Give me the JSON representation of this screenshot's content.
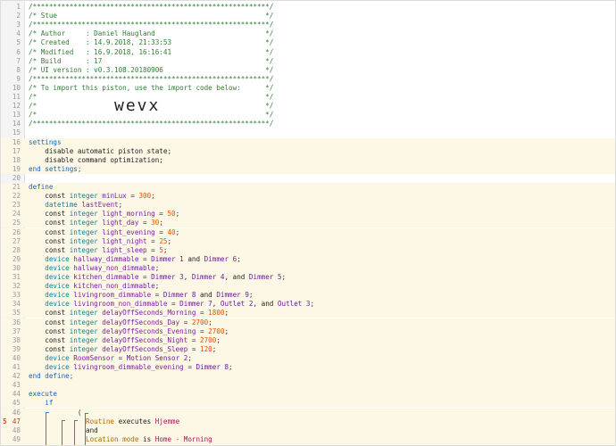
{
  "editor": {
    "banner_text": "wevx",
    "error_marker": "5",
    "lines": [
      {
        "n": "1",
        "segs": [
          {
            "t": "/**********************************************************/",
            "c": "comment"
          }
        ]
      },
      {
        "n": "2",
        "segs": [
          {
            "t": "/* Stue                                                   */",
            "c": "comment"
          }
        ]
      },
      {
        "n": "3",
        "segs": [
          {
            "t": "/**********************************************************/",
            "c": "comment"
          }
        ]
      },
      {
        "n": "4",
        "segs": [
          {
            "t": "/* Author     : Daniel Haugland                           */",
            "c": "comment"
          }
        ]
      },
      {
        "n": "5",
        "segs": [
          {
            "t": "/* Created    : 14.9.2018, 21:33:53                       */",
            "c": "comment"
          }
        ]
      },
      {
        "n": "6",
        "segs": [
          {
            "t": "/* Modified   : 16.9.2018, 16:16:41                       */",
            "c": "comment"
          }
        ]
      },
      {
        "n": "7",
        "segs": [
          {
            "t": "/* Build      : 17                                        */",
            "c": "comment"
          }
        ]
      },
      {
        "n": "8",
        "segs": [
          {
            "t": "/* UI version : v0.3.108.20180906                         */",
            "c": "comment"
          }
        ]
      },
      {
        "n": "9",
        "segs": [
          {
            "t": "/**********************************************************/",
            "c": "comment"
          }
        ]
      },
      {
        "n": "10",
        "segs": [
          {
            "t": "/* To import this piston, use the import code below:      */",
            "c": "comment"
          }
        ]
      },
      {
        "n": "11",
        "segs": [
          {
            "t": "/*                                                        */",
            "c": "comment"
          }
        ]
      },
      {
        "n": "12",
        "segs": [
          {
            "t": "/*                                                        */",
            "c": "comment"
          }
        ]
      },
      {
        "n": "13",
        "segs": [
          {
            "t": "/*                                                        */",
            "c": "comment"
          }
        ]
      },
      {
        "n": "14",
        "segs": [
          {
            "t": "/**********************************************************/",
            "c": "comment"
          }
        ]
      },
      {
        "n": "15",
        "segs": []
      },
      {
        "n": "16",
        "segs": [
          {
            "t": "settings",
            "c": "kw"
          }
        ]
      },
      {
        "n": "17",
        "segs": [
          {
            "t": "    disable automatic piston state;",
            "c": "plain"
          }
        ]
      },
      {
        "n": "18",
        "segs": [
          {
            "t": "    disable command optimization;",
            "c": "plain"
          }
        ]
      },
      {
        "n": "19",
        "segs": [
          {
            "t": "end settings;",
            "c": "kw"
          }
        ]
      },
      {
        "n": "20",
        "segs": []
      },
      {
        "n": "21",
        "segs": [
          {
            "t": "define",
            "c": "kw"
          }
        ]
      },
      {
        "n": "22",
        "segs": [
          {
            "t": "    const ",
            "c": "plain"
          },
          {
            "t": "integer ",
            "c": "type"
          },
          {
            "t": "minLux",
            "c": "decl"
          },
          {
            "t": " = ",
            "c": "op"
          },
          {
            "t": "300",
            "c": "num"
          },
          {
            "t": ";",
            "c": "op"
          }
        ]
      },
      {
        "n": "23",
        "segs": [
          {
            "t": "    datetime ",
            "c": "type"
          },
          {
            "t": "lastEvent",
            "c": "decl"
          },
          {
            "t": ";",
            "c": "op"
          }
        ]
      },
      {
        "n": "24",
        "segs": [
          {
            "t": "    const ",
            "c": "plain"
          },
          {
            "t": "integer ",
            "c": "type"
          },
          {
            "t": "light_morning",
            "c": "decl"
          },
          {
            "t": " = ",
            "c": "op"
          },
          {
            "t": "50",
            "c": "num"
          },
          {
            "t": ";",
            "c": "op"
          }
        ]
      },
      {
        "n": "25",
        "segs": [
          {
            "t": "    const ",
            "c": "plain"
          },
          {
            "t": "integer ",
            "c": "type"
          },
          {
            "t": "light_day",
            "c": "decl"
          },
          {
            "t": " = ",
            "c": "op"
          },
          {
            "t": "30",
            "c": "num"
          },
          {
            "t": ";",
            "c": "op"
          }
        ]
      },
      {
        "n": "26",
        "segs": [
          {
            "t": "    const ",
            "c": "plain"
          },
          {
            "t": "integer ",
            "c": "type"
          },
          {
            "t": "light_evening",
            "c": "decl"
          },
          {
            "t": " = ",
            "c": "op"
          },
          {
            "t": "40",
            "c": "num"
          },
          {
            "t": ";",
            "c": "op"
          }
        ]
      },
      {
        "n": "27",
        "segs": [
          {
            "t": "    const ",
            "c": "plain"
          },
          {
            "t": "integer ",
            "c": "type"
          },
          {
            "t": "light_night",
            "c": "decl"
          },
          {
            "t": " = ",
            "c": "op"
          },
          {
            "t": "25",
            "c": "num"
          },
          {
            "t": ";",
            "c": "op"
          }
        ]
      },
      {
        "n": "28",
        "segs": [
          {
            "t": "    const ",
            "c": "plain"
          },
          {
            "t": "integer ",
            "c": "type"
          },
          {
            "t": "light_sleep",
            "c": "decl"
          },
          {
            "t": " = ",
            "c": "op"
          },
          {
            "t": "5",
            "c": "num"
          },
          {
            "t": ";",
            "c": "op"
          }
        ]
      },
      {
        "n": "29",
        "segs": [
          {
            "t": "    device ",
            "c": "type"
          },
          {
            "t": "hallway_dimmable",
            "c": "decl"
          },
          {
            "t": " = ",
            "c": "op"
          },
          {
            "t": "Dimmer 1",
            "c": "dev"
          },
          {
            "t": " and ",
            "c": "plain"
          },
          {
            "t": "Dimmer 6",
            "c": "dev"
          },
          {
            "t": ";",
            "c": "op"
          }
        ]
      },
      {
        "n": "30",
        "segs": [
          {
            "t": "    device ",
            "c": "type"
          },
          {
            "t": "hallway_non_dimmable",
            "c": "decl"
          },
          {
            "t": ";",
            "c": "op"
          }
        ]
      },
      {
        "n": "31",
        "segs": [
          {
            "t": "    device ",
            "c": "type"
          },
          {
            "t": "kitchen_dimmable",
            "c": "decl"
          },
          {
            "t": " = ",
            "c": "op"
          },
          {
            "t": "Dimmer 3",
            "c": "dev"
          },
          {
            "t": ", ",
            "c": "plain"
          },
          {
            "t": "Dimmer 4",
            "c": "dev"
          },
          {
            "t": ", and ",
            "c": "plain"
          },
          {
            "t": "Dimmer 5",
            "c": "dev"
          },
          {
            "t": ";",
            "c": "op"
          }
        ]
      },
      {
        "n": "32",
        "segs": [
          {
            "t": "    device ",
            "c": "type"
          },
          {
            "t": "kitchen_non_dimmable",
            "c": "decl"
          },
          {
            "t": ";",
            "c": "op"
          }
        ]
      },
      {
        "n": "33",
        "segs": [
          {
            "t": "    device ",
            "c": "type"
          },
          {
            "t": "livingroom_dimmable",
            "c": "decl"
          },
          {
            "t": " = ",
            "c": "op"
          },
          {
            "t": "Dimmer 8",
            "c": "dev"
          },
          {
            "t": " and ",
            "c": "plain"
          },
          {
            "t": "Dimmer 9",
            "c": "dev"
          },
          {
            "t": ";",
            "c": "op"
          }
        ]
      },
      {
        "n": "34",
        "segs": [
          {
            "t": "    device ",
            "c": "type"
          },
          {
            "t": "livingroom_non_dimmable",
            "c": "decl"
          },
          {
            "t": " = ",
            "c": "op"
          },
          {
            "t": "Dimmer 7",
            "c": "dev"
          },
          {
            "t": ", ",
            "c": "plain"
          },
          {
            "t": "Outlet 2",
            "c": "dev"
          },
          {
            "t": ", and ",
            "c": "plain"
          },
          {
            "t": "Outlet 3",
            "c": "dev"
          },
          {
            "t": ";",
            "c": "op"
          }
        ]
      },
      {
        "n": "35",
        "segs": [
          {
            "t": "    const ",
            "c": "plain"
          },
          {
            "t": "integer ",
            "c": "type"
          },
          {
            "t": "delayOffSeconds_Morning",
            "c": "decl"
          },
          {
            "t": " = ",
            "c": "op"
          },
          {
            "t": "1800",
            "c": "num"
          },
          {
            "t": ";",
            "c": "op"
          }
        ]
      },
      {
        "n": "36",
        "segs": [
          {
            "t": "    const ",
            "c": "plain"
          },
          {
            "t": "integer ",
            "c": "type"
          },
          {
            "t": "delayOffSeconds_Day",
            "c": "decl"
          },
          {
            "t": " = ",
            "c": "op"
          },
          {
            "t": "2700",
            "c": "num"
          },
          {
            "t": ";",
            "c": "op"
          }
        ]
      },
      {
        "n": "37",
        "segs": [
          {
            "t": "    const ",
            "c": "plain"
          },
          {
            "t": "integer ",
            "c": "type"
          },
          {
            "t": "delayOffSeconds_Evening",
            "c": "decl"
          },
          {
            "t": " = ",
            "c": "op"
          },
          {
            "t": "2700",
            "c": "num"
          },
          {
            "t": ";",
            "c": "op"
          }
        ]
      },
      {
        "n": "38",
        "segs": [
          {
            "t": "    const ",
            "c": "plain"
          },
          {
            "t": "integer ",
            "c": "type"
          },
          {
            "t": "delayOffSeconds_Night",
            "c": "decl"
          },
          {
            "t": " = ",
            "c": "op"
          },
          {
            "t": "2700",
            "c": "num"
          },
          {
            "t": ";",
            "c": "op"
          }
        ]
      },
      {
        "n": "39",
        "segs": [
          {
            "t": "    const ",
            "c": "plain"
          },
          {
            "t": "integer ",
            "c": "type"
          },
          {
            "t": "delayOffSeconds_Sleep",
            "c": "decl"
          },
          {
            "t": " = ",
            "c": "op"
          },
          {
            "t": "120",
            "c": "num"
          },
          {
            "t": ";",
            "c": "op"
          }
        ]
      },
      {
        "n": "40",
        "segs": [
          {
            "t": "    device ",
            "c": "type"
          },
          {
            "t": "RoomSensor",
            "c": "decl"
          },
          {
            "t": " = ",
            "c": "op"
          },
          {
            "t": "Motion Sensor 2",
            "c": "dev"
          },
          {
            "t": ";",
            "c": "op"
          }
        ]
      },
      {
        "n": "41",
        "segs": [
          {
            "t": "    device ",
            "c": "type"
          },
          {
            "t": "livingroom_dimmable_evening",
            "c": "decl"
          },
          {
            "t": " = ",
            "c": "op"
          },
          {
            "t": "Dimmer 8",
            "c": "dev"
          },
          {
            "t": ";",
            "c": "op"
          }
        ]
      },
      {
        "n": "42",
        "segs": [
          {
            "t": "end define;",
            "c": "kw"
          }
        ]
      },
      {
        "n": "43",
        "segs": []
      },
      {
        "n": "44",
        "segs": [
          {
            "t": "execute",
            "c": "kw"
          }
        ]
      },
      {
        "n": "45",
        "segs": [
          {
            "t": "    if",
            "c": "kw"
          }
        ]
      },
      {
        "n": "46",
        "segs": [
          {
            "t": "            (",
            "c": "op"
          }
        ]
      },
      {
        "n": "47",
        "segs": [
          {
            "t": "              Routine",
            "c": "event"
          },
          {
            "t": " executes ",
            "c": "plain"
          },
          {
            "t": "Hjemme",
            "c": "val"
          }
        ]
      },
      {
        "n": "48",
        "segs": [
          {
            "t": "              and",
            "c": "plain"
          }
        ]
      },
      {
        "n": "49",
        "segs": [
          {
            "t": "              Location mode",
            "c": "event"
          },
          {
            "t": " is ",
            "c": "plain"
          },
          {
            "t": "Home - Morning",
            "c": "val"
          }
        ]
      },
      {
        "n": "50",
        "segs": [
          {
            "t": "            )",
            "c": "op"
          }
        ]
      }
    ]
  }
}
